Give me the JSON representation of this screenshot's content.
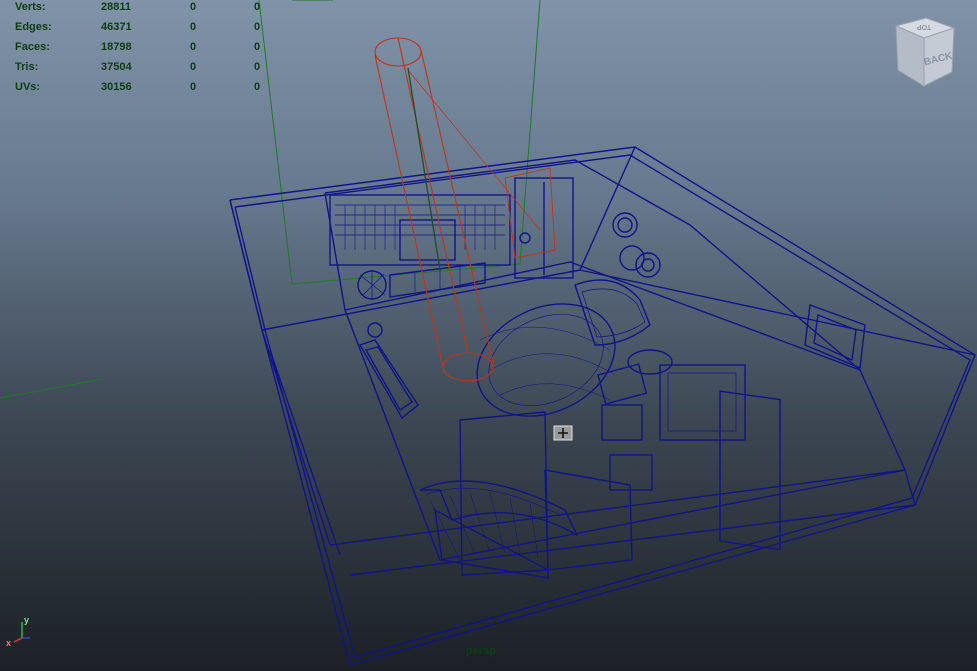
{
  "stats": {
    "rows": [
      {
        "label": "Verts:",
        "total": "28811",
        "selected": "0",
        "component": "0"
      },
      {
        "label": "Edges:",
        "total": "46371",
        "selected": "0",
        "component": "0"
      },
      {
        "label": "Faces:",
        "total": "18798",
        "selected": "0",
        "component": "0"
      },
      {
        "label": "Tris:",
        "total": "37504",
        "selected": "0",
        "component": "0"
      },
      {
        "label": "UVs:",
        "total": "30156",
        "selected": "0",
        "component": "0"
      }
    ]
  },
  "camera_name": "persp",
  "view_cube": {
    "face_front": "BACK",
    "face_top": "TOP"
  },
  "axis": {
    "x": "x",
    "y": "y"
  },
  "colors": {
    "wireframe": "#111489",
    "selected_wire": "#c1331a",
    "grid_axis": "#1d7a2a",
    "hud_text": "#0c3d12"
  }
}
